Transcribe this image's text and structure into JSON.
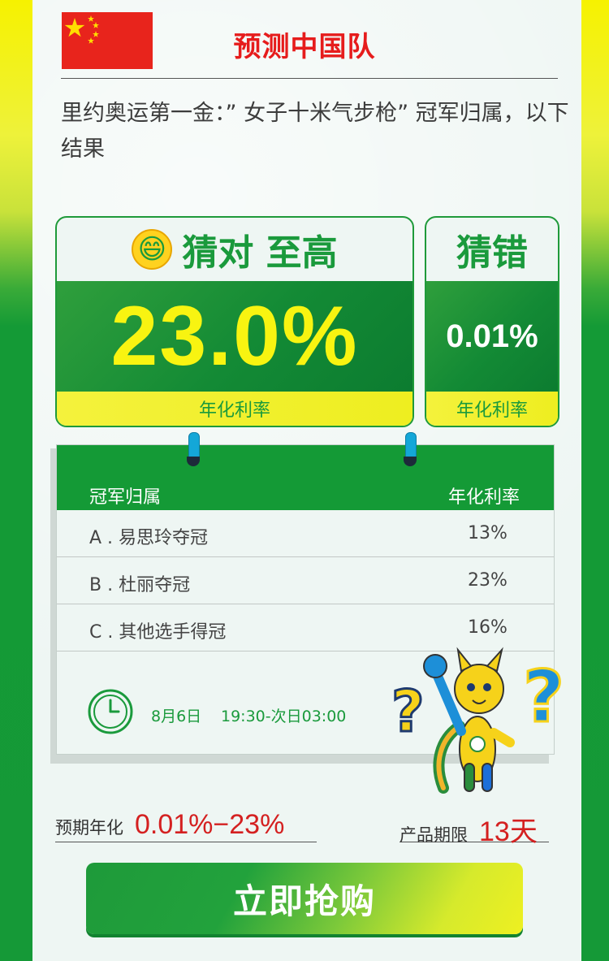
{
  "header": {
    "team_title": "预测中国队",
    "question": "里约奥运第一金：” 女子十米气步枪” 冠军归属，以下结果"
  },
  "cards": {
    "correct": {
      "emoji": "😄",
      "label": "猜对 至高",
      "rate": "23.0%",
      "foot": "年化利率"
    },
    "wrong": {
      "label": "猜错",
      "rate": "0.01%",
      "foot": "年化利率"
    }
  },
  "table": {
    "col1": "冠军归属",
    "col2": "年化利率",
    "rows": [
      {
        "name": "A . 易思玲夺冠",
        "rate": "13%"
      },
      {
        "name": "B . 杜丽夺冠",
        "rate": "23%"
      },
      {
        "name": "C . 其他选手得冠",
        "rate": "16%"
      }
    ],
    "date": "8月6日",
    "time": "19:30-次日03:00"
  },
  "summary": {
    "expected_label": "预期年化",
    "expected_value": "0.01%−23%",
    "term_label": "产品期限",
    "term_value": "13天"
  },
  "cta": {
    "label": "立即抢购"
  },
  "colors": {
    "brand_green": "#149a36",
    "accent_yellow": "#f8f411",
    "title_red": "#e61c1c",
    "value_red": "#d42020"
  },
  "icons": [
    "china-flag-icon",
    "grin-emoji-icon",
    "clock-icon",
    "mascot-illustration"
  ]
}
